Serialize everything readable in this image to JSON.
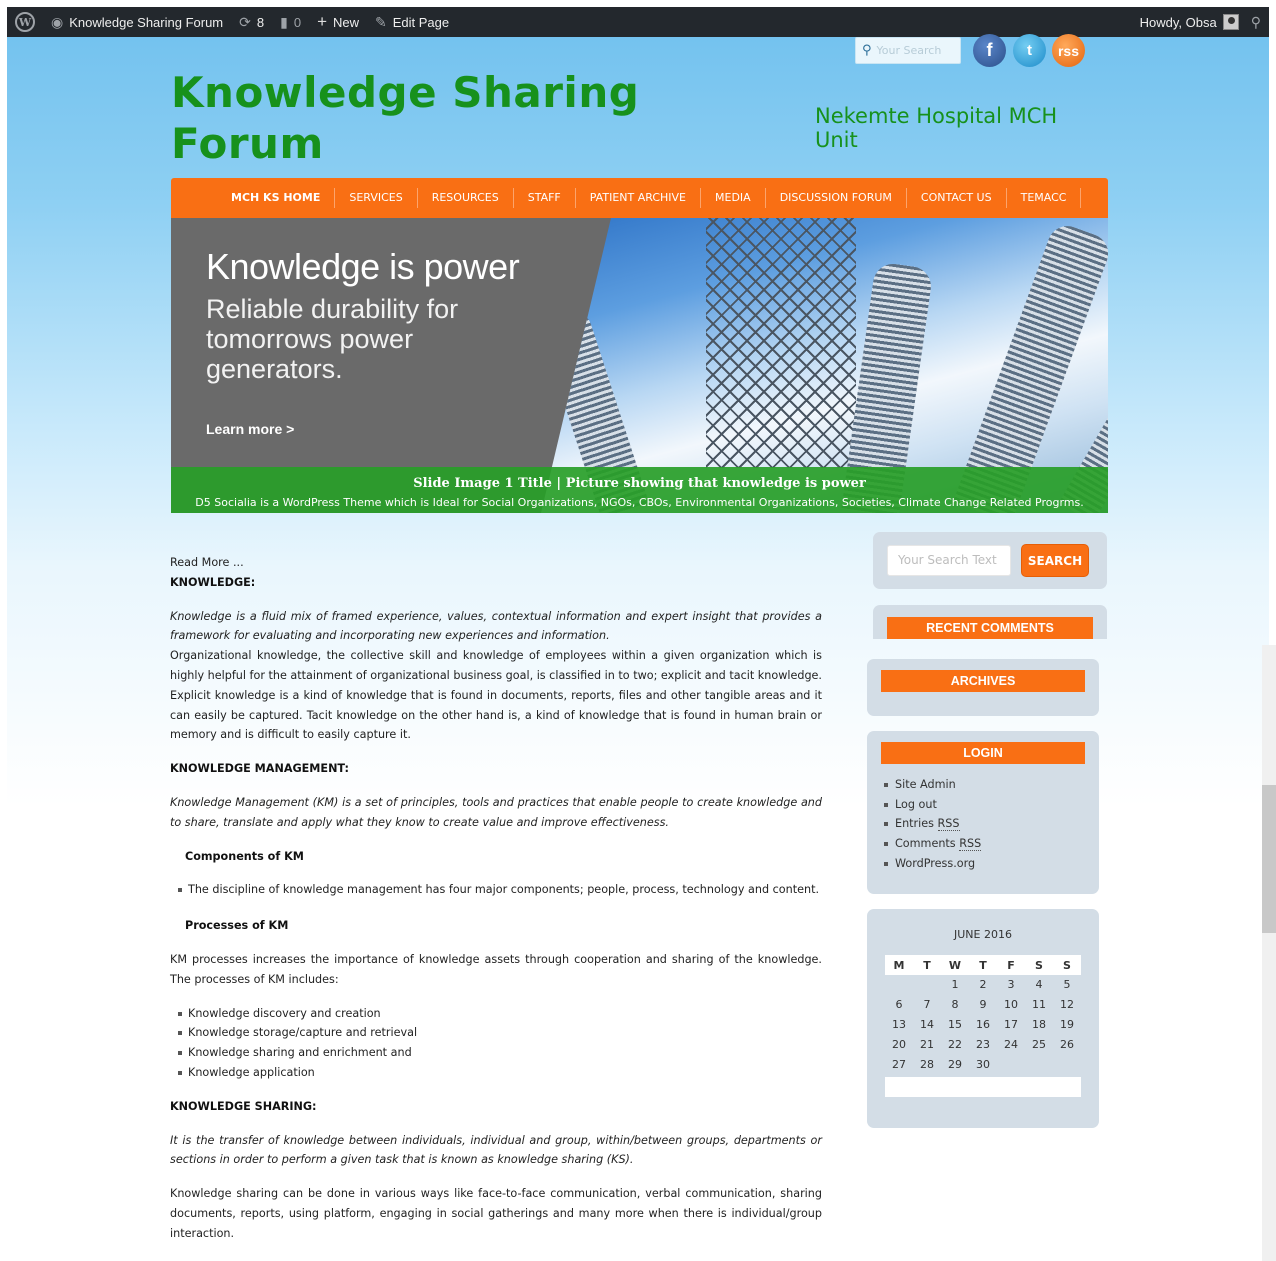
{
  "adminbar": {
    "wp_logo": "W",
    "site_name": "Knowledge Sharing Forum",
    "updates_count": "8",
    "comments_count": "0",
    "new_label": "New",
    "edit_label": "Edit Page",
    "howdy": "Howdy, Obsa"
  },
  "header": {
    "search_placeholder": "Your Search",
    "title_line1": "Knowledge Sharing",
    "title_line2": "Forum",
    "description": "Nekemte Hospital MCH Unit"
  },
  "nav": {
    "items": [
      "MCH KS HOME",
      "SERVICES",
      "RESOURCES",
      "STAFF",
      "PATIENT ARCHIVE",
      "MEDIA",
      "DISCUSSION FORUM",
      "CONTACT US",
      "TEMACC"
    ]
  },
  "slider": {
    "heading": "Knowledge is power",
    "subheading": "Reliable durability for tomorrows power generators.",
    "learn_more": "Learn more >",
    "caption_title": "Slide Image 1 Title | Picture showing that knowledge is power",
    "caption_desc": "D5 Socialia is a WordPress Theme which is Ideal for Social Organizations, NGOs, CBOs, Environmental Organizations, Societies, Climate Change Related Progrms."
  },
  "content": {
    "read_more": "Read More ...",
    "h_knowledge": "KNOWLEDGE:",
    "p_knowledge_def": "Knowledge is a fluid mix of framed experience, values, contextual information and expert insight that provides a framework for evaluating and incorporating new experiences and information.",
    "p_org_knowledge": "Organizational knowledge, the collective skill and knowledge of employees within a given organization which is highly helpful for the attainment of organizational business goal, is classified in to two; explicit and tacit knowledge. Explicit knowledge is a kind of knowledge that is found in documents, reports, files and other tangible areas and it can easily be captured. Tacit knowledge on the other hand is, a kind of knowledge that is found in human brain or memory and is difficult to easily capture it.",
    "h_km": "KNOWLEDGE MANAGEMENT:",
    "p_km_def": "Knowledge Management (KM) is a set of principles, tools and practices that enable people to create knowledge and to share, translate and apply what they know to create value and improve effectiveness.",
    "h_components": "Components of KM",
    "components_items": [
      "The discipline of knowledge management has four major components; people, process, technology and content."
    ],
    "h_processes": "Processes of KM",
    "p_processes": "KM processes increases the importance of knowledge assets through cooperation and sharing of the knowledge. The processes of KM includes:",
    "process_items": [
      "Knowledge discovery and creation",
      "Knowledge storage/capture and retrieval",
      "Knowledge sharing and enrichment and",
      "Knowledge application"
    ],
    "h_sharing": "KNOWLEDGE SHARING:",
    "p_sharing_def": "It is the transfer of knowledge between individuals, individual and group, within/between groups, departments or sections in order to perform a given task that is known as knowledge sharing (KS).",
    "p_sharing_ways": "Knowledge sharing can be done in various ways like face-to-face communication, verbal communication, sharing documents, reports, using platform, engaging in social gatherings and many more when there is individual/group interaction."
  },
  "sidebar": {
    "search_placeholder": "Your Search Text",
    "search_button": "SEARCH",
    "recent_comments": "RECENT COMMENTS",
    "archives": "ARCHIVES",
    "login": "LOGIN",
    "login_links": [
      "Site Admin",
      "Log out",
      "Entries",
      "Comments",
      "WordPress.org"
    ],
    "rss_label": "RSS",
    "calendar": {
      "caption": "JUNE 2016",
      "headers": [
        "M",
        "T",
        "W",
        "T",
        "F",
        "S",
        "S"
      ],
      "weeks": [
        [
          "",
          "",
          "1",
          "2",
          "3",
          "4",
          "5"
        ],
        [
          "6",
          "7",
          "8",
          "9",
          "10",
          "11",
          "12"
        ],
        [
          "13",
          "14",
          "15",
          "16",
          "17",
          "18",
          "19"
        ],
        [
          "20",
          "21",
          "22",
          "23",
          "24",
          "25",
          "26"
        ],
        [
          "27",
          "28",
          "29",
          "30",
          "",
          "",
          ""
        ]
      ]
    }
  },
  "social": {
    "facebook": "f",
    "twitter": "t",
    "rss": "rss"
  },
  "colors": {
    "accent_orange": "#f96f14",
    "title_green": "#17911c",
    "adminbar": "#23282d"
  }
}
